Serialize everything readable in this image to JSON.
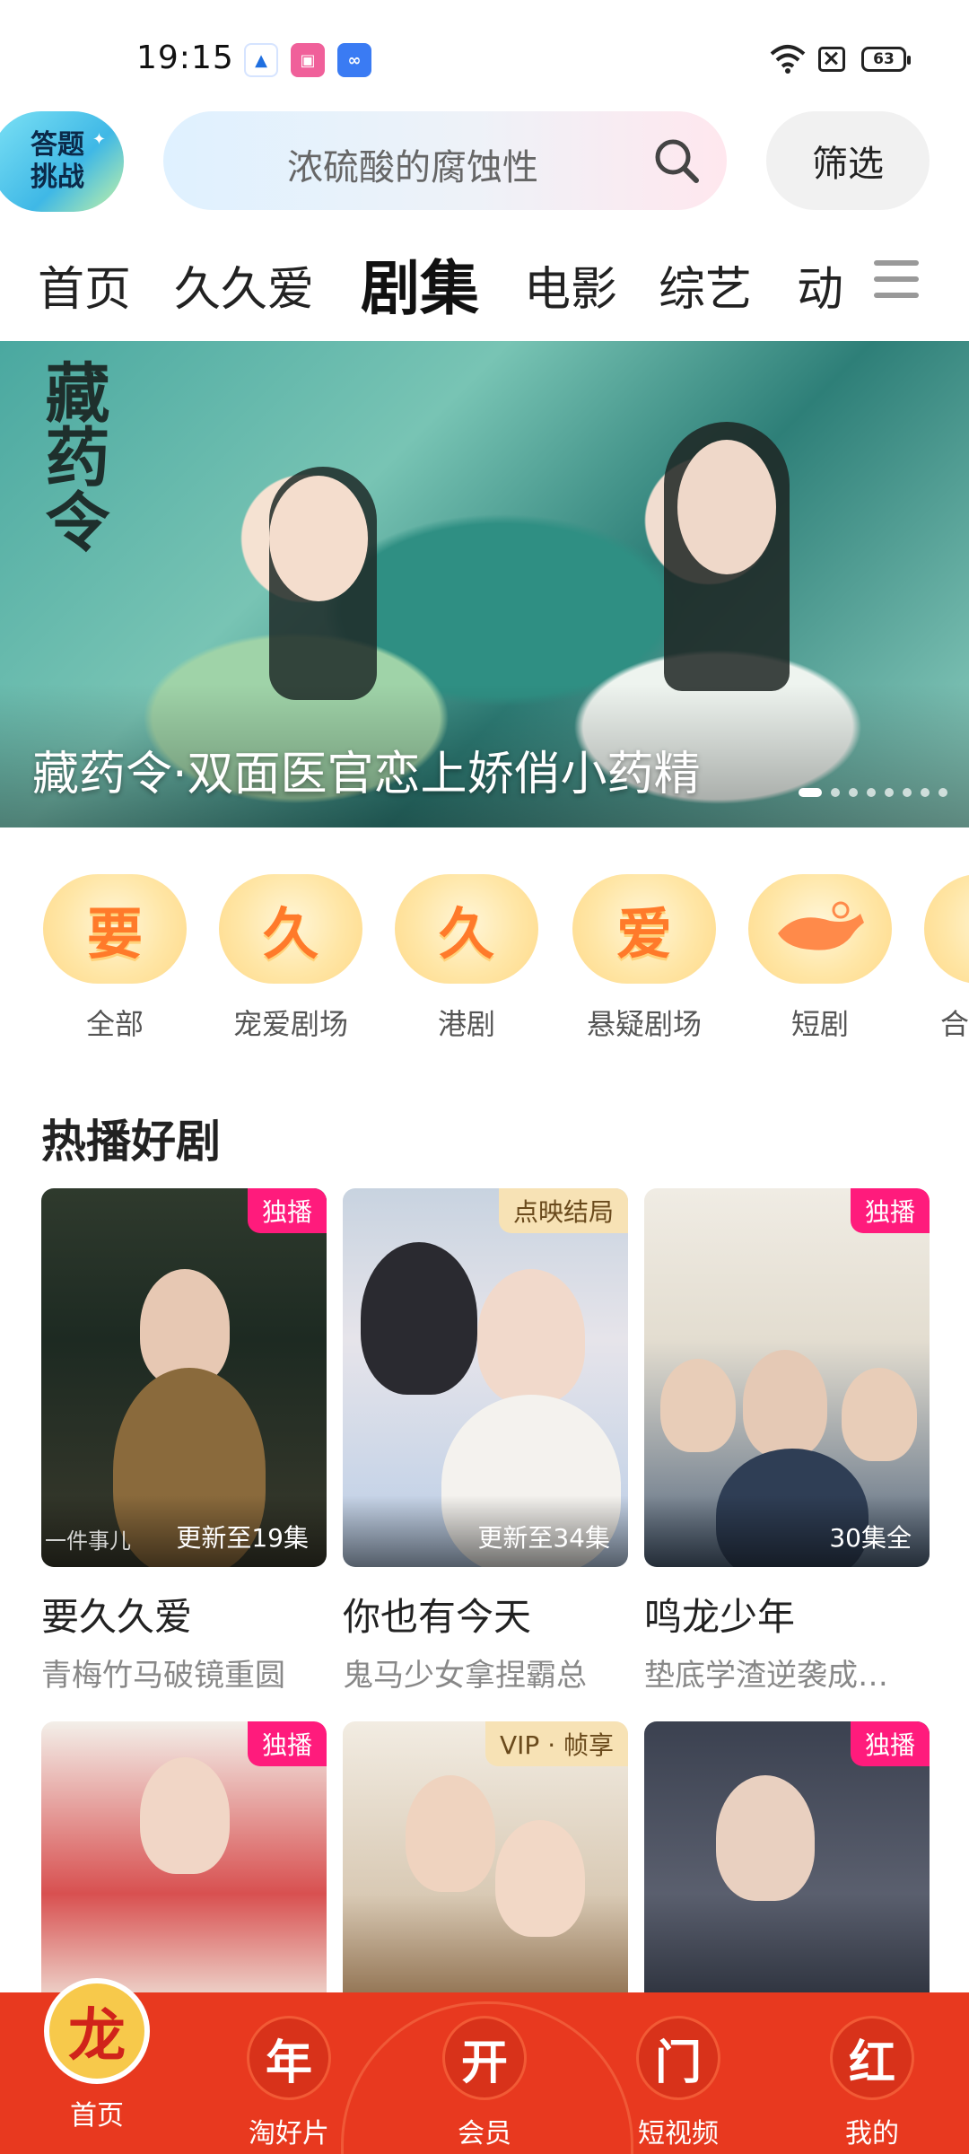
{
  "status_bar": {
    "time": "19:15",
    "battery": "63",
    "apps": [
      "app-a",
      "bili",
      "infinity"
    ],
    "icons": [
      "wifi-icon",
      "sim-icon",
      "battery-icon"
    ]
  },
  "header": {
    "quiz_badge_line1": "答题",
    "quiz_badge_line2": "挑战",
    "search_placeholder": "浓硫酸的腐蚀性",
    "filter_label": "筛选"
  },
  "tabs": [
    {
      "label": "首页",
      "active": false
    },
    {
      "label": "久久爱",
      "active": false
    },
    {
      "label": "剧集",
      "active": true
    },
    {
      "label": "电影",
      "active": false
    },
    {
      "label": "综艺",
      "active": false
    },
    {
      "label": "动",
      "active": false
    }
  ],
  "banner": {
    "calligraphy": "藏药令",
    "title": "藏药令·双面医官恋上娇俏小药精",
    "dot_count": 8,
    "active_dot": 0
  },
  "categories": [
    {
      "glyph": "要",
      "label": "全部"
    },
    {
      "glyph": "久",
      "label": "宠爱剧场"
    },
    {
      "glyph": "久",
      "label": "港剧"
    },
    {
      "glyph": "爱",
      "label": "悬疑剧场"
    },
    {
      "glyph": "",
      "label": "短剧"
    },
    {
      "glyph": "",
      "label": "合"
    }
  ],
  "section": {
    "title": "热播好剧"
  },
  "cards": [
    {
      "badge": "独播",
      "badge_style": "pink",
      "episode": "更新至19集",
      "poster_tag": "一件事儿",
      "title": "要久久爱",
      "subtitle": "青梅竹马破镜重圆"
    },
    {
      "badge": "点映结局",
      "badge_style": "gold",
      "episode": "更新至34集",
      "poster_tag": "",
      "title": "你也有今天",
      "subtitle": "鬼马少女拿捏霸总"
    },
    {
      "badge": "独播",
      "badge_style": "pink",
      "episode": "30集全",
      "poster_tag": "",
      "title": "鸣龙少年",
      "subtitle": "垫底学渣逆袭成…"
    },
    {
      "badge": "独播",
      "badge_style": "pink",
      "episode": "",
      "poster_tag": "",
      "title": "",
      "subtitle": ""
    },
    {
      "badge": "VIP · 帧享",
      "badge_style": "gold",
      "episode": "",
      "poster_tag": "",
      "title": "",
      "subtitle": ""
    },
    {
      "badge": "独播",
      "badge_style": "pink",
      "episode": "",
      "poster_tag": "",
      "title": "",
      "subtitle": ""
    }
  ],
  "bottom_nav": [
    {
      "glyph": "龙",
      "label": "首页",
      "active": true
    },
    {
      "glyph": "年",
      "label": "淘好片",
      "active": false
    },
    {
      "glyph": "开",
      "label": "会员",
      "active": false
    },
    {
      "glyph": "门",
      "label": "短视频",
      "active": false
    },
    {
      "glyph": "红",
      "label": "我的",
      "active": false
    }
  ],
  "colors": {
    "accent_pink": "#ff1b7c",
    "nav_red": "#e8391f",
    "badge_gold": "#f7e2b5"
  }
}
